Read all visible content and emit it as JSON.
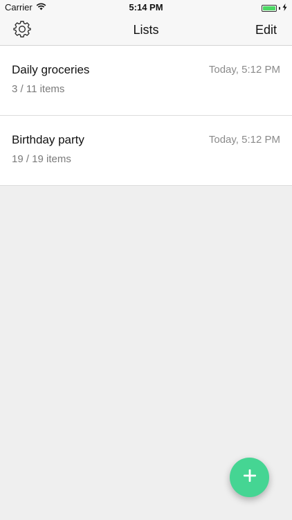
{
  "status_bar": {
    "carrier": "Carrier",
    "time": "5:14 PM",
    "wifi_icon": "wifi-icon",
    "battery_icon": "battery-charging-icon",
    "battery_level_percent": 100,
    "battery_color": "#4cd964"
  },
  "navbar": {
    "title": "Lists",
    "settings_icon": "gear-icon",
    "edit_label": "Edit"
  },
  "lists": [
    {
      "name": "Daily groceries",
      "count": "3 / 11 items",
      "time": "Today, 5:12 PM"
    },
    {
      "name": "Birthday party",
      "count": "19 / 19 items",
      "time": "Today, 5:12 PM"
    }
  ],
  "fab": {
    "icon": "plus-icon",
    "color": "#45d593"
  }
}
